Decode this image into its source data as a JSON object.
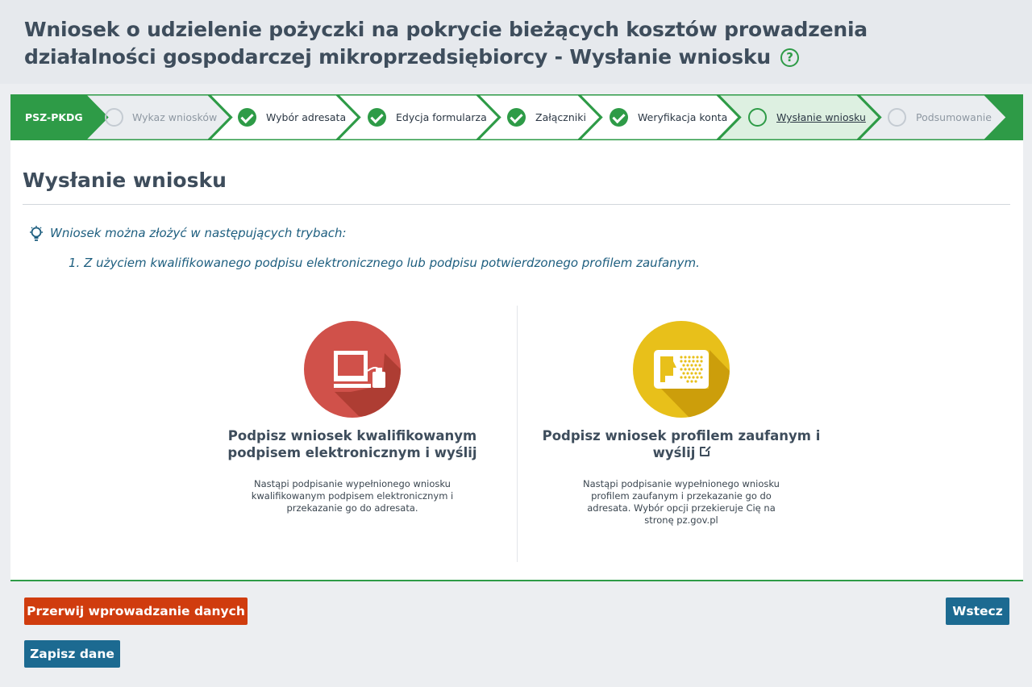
{
  "header": {
    "title": "Wniosek o udzielenie pożyczki na pokrycie bieżących kosztów prowadzenia działalności gospodarczej mikroprzedsiębiorcy - Wysłanie wniosku",
    "help_symbol": "?"
  },
  "steps": {
    "code": "PSZ-PKDG",
    "items": [
      {
        "label": "Wykaz wniosków",
        "state": "todo"
      },
      {
        "label": "Wybór adresata",
        "state": "done"
      },
      {
        "label": "Edycja formularza",
        "state": "done"
      },
      {
        "label": "Załączniki",
        "state": "done"
      },
      {
        "label": "Weryfikacja konta",
        "state": "done"
      },
      {
        "label": "Wysłanie wniosku",
        "state": "current"
      },
      {
        "label": "Podsumowanie",
        "state": "todo"
      }
    ]
  },
  "main": {
    "title": "Wysłanie wniosku",
    "info_intro": "Wniosek można złożyć w następujących trybach:",
    "info_items": [
      "1. Z użyciem kwalifikowanego podpisu elektronicznego lub podpisu potwierdzonego profilem zaufanym."
    ],
    "options": [
      {
        "title": "Podpisz wniosek kwalifikowanym podpisem elektronicznym i wyślij",
        "description": "Nastąpi podpisanie wypełnionego wniosku kwalifikowanym podpisem elektronicznym i przekazanie go do adresata.",
        "icon": "computer-signature-icon",
        "color": "#d0514a"
      },
      {
        "title": "Podpisz wniosek profilem zaufanym i wyślij",
        "description": "Nastąpi podpisanie wypełnionego wniosku profilem zaufanym i przekazanie go do adresata. Wybór opcji przekieruje Cię na stronę pz.gov.pl",
        "icon": "trusted-profile-icon",
        "color": "#e8c01a"
      }
    ]
  },
  "buttons": {
    "cancel": "Przerwij wprowadzanie danych",
    "back": "Wstecz",
    "save": "Zapisz dane"
  },
  "colors": {
    "accent": "#2e9b47",
    "danger": "#d03c0e",
    "primary": "#1c6a91"
  }
}
